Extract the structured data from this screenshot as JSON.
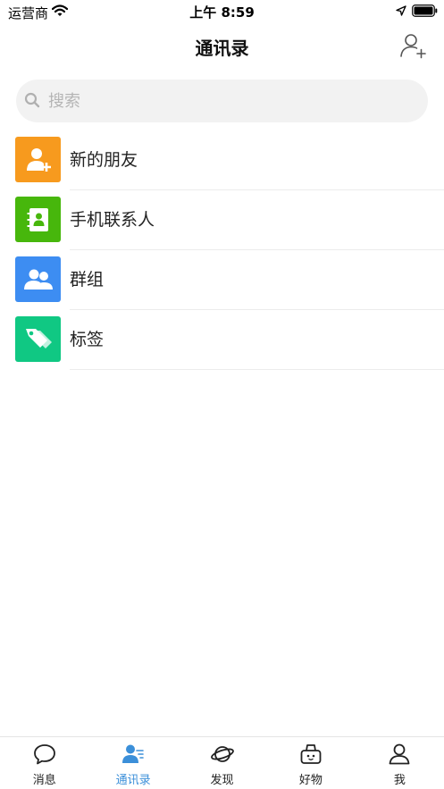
{
  "status_bar": {
    "carrier": "运营商",
    "time": "上午 8:59"
  },
  "nav": {
    "title": "通讯录",
    "add_icon": "add-contact-icon"
  },
  "search": {
    "placeholder": "搜索",
    "value": ""
  },
  "list": [
    {
      "label": "新的朋友",
      "icon": "new-friend-icon",
      "color": "#f79a1e"
    },
    {
      "label": "手机联系人",
      "icon": "phone-contacts-icon",
      "color": "#47b70c"
    },
    {
      "label": "群组",
      "icon": "group-icon",
      "color": "#3d8df2"
    },
    {
      "label": "标签",
      "icon": "tag-icon",
      "color": "#10c883"
    }
  ],
  "tabs": [
    {
      "label": "消息",
      "icon": "message-icon",
      "active": false
    },
    {
      "label": "通讯录",
      "icon": "contacts-icon",
      "active": true
    },
    {
      "label": "发现",
      "icon": "planet-icon",
      "active": false
    },
    {
      "label": "好物",
      "icon": "basket-icon",
      "active": false
    },
    {
      "label": "我",
      "icon": "profile-icon",
      "active": false
    }
  ],
  "colors": {
    "accent": "#3b8fd9",
    "search_bg": "#f2f2f2"
  }
}
